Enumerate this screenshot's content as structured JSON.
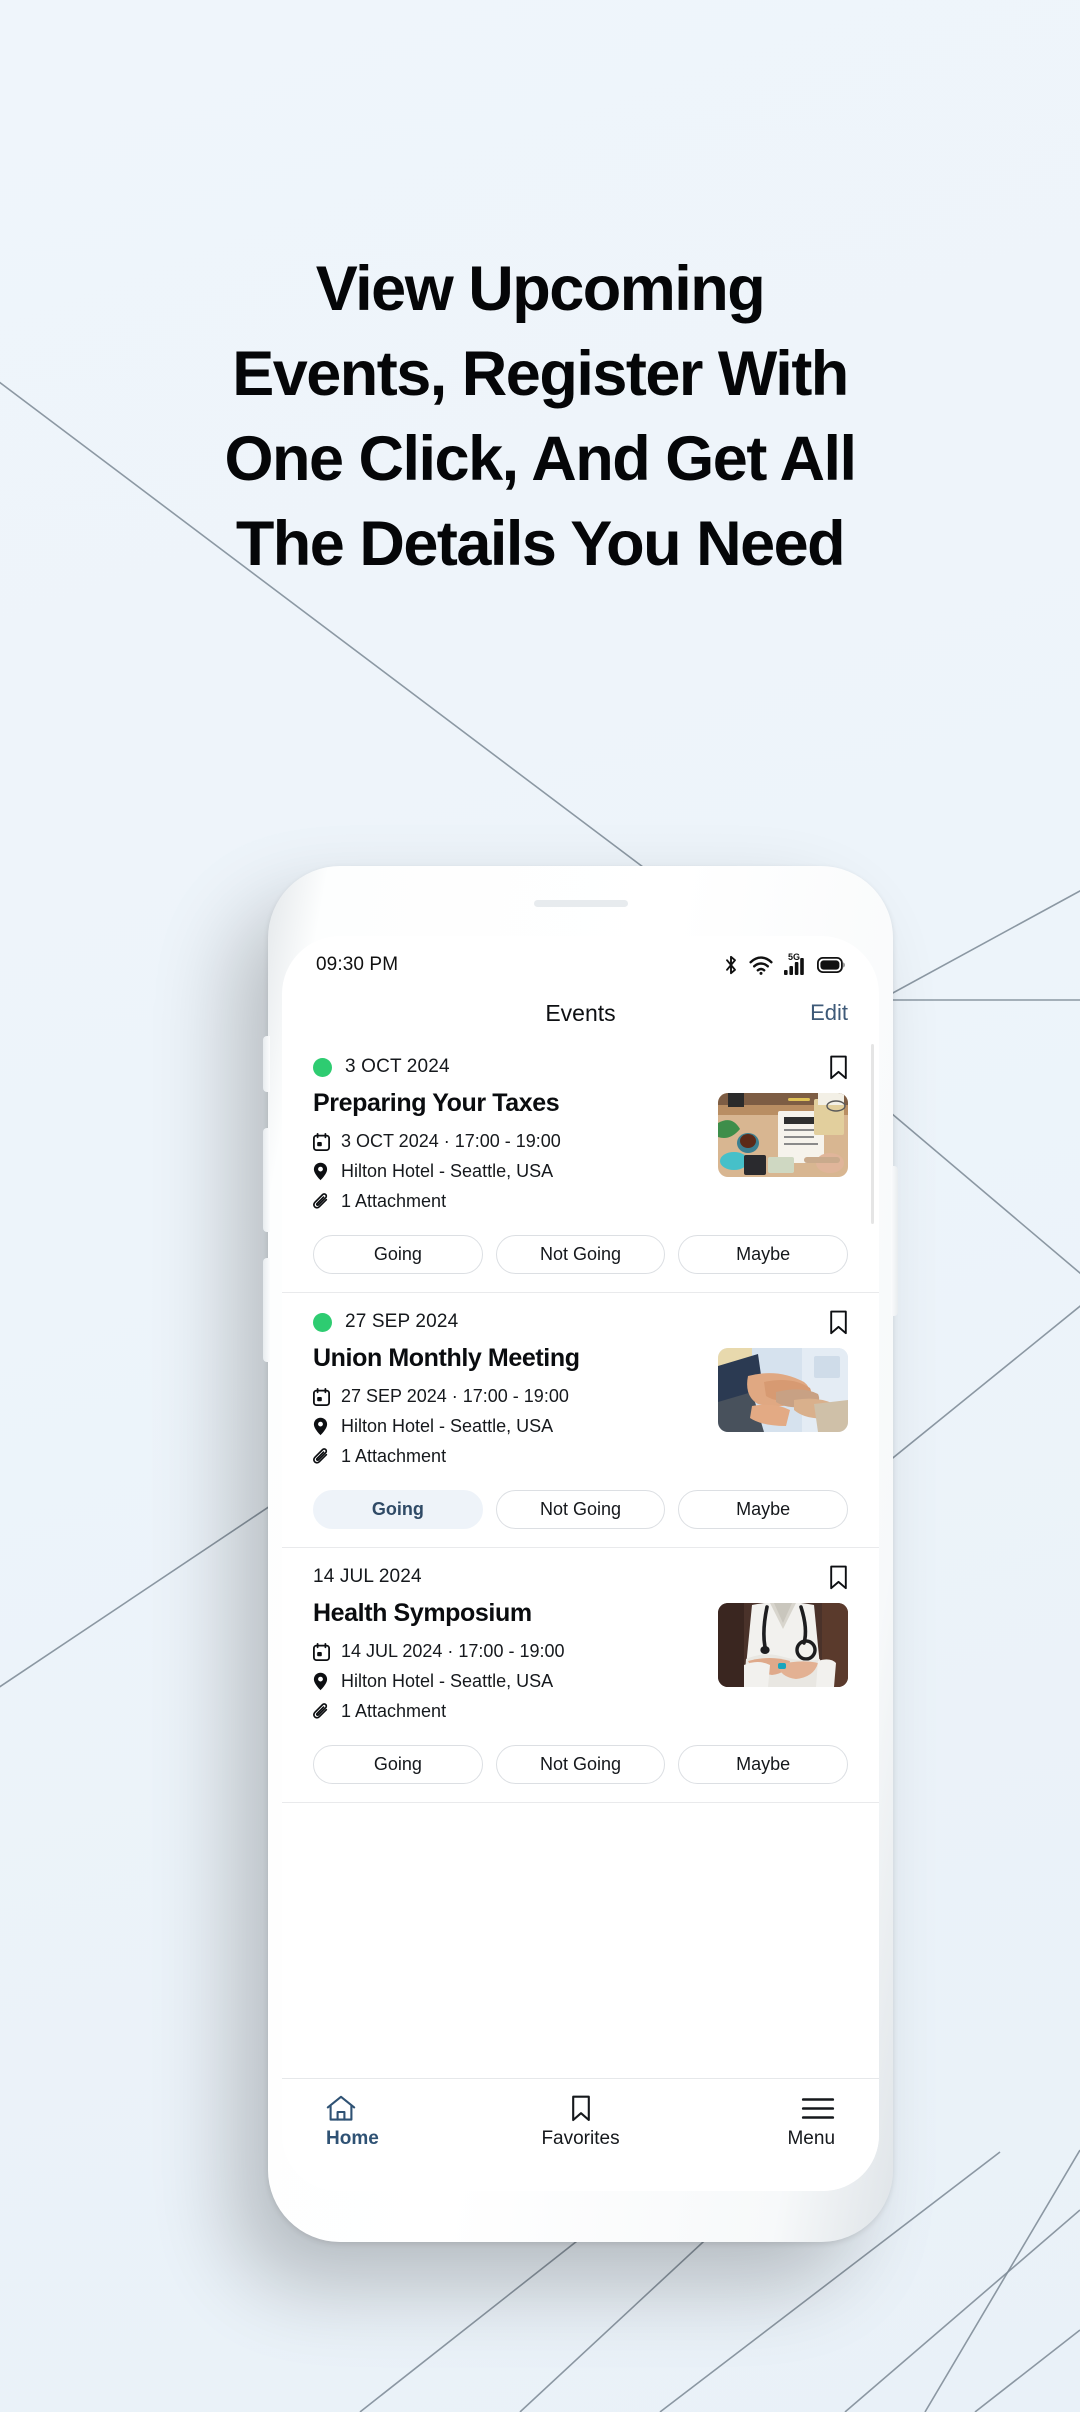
{
  "headline": {
    "lines": [
      "View Upcoming",
      "Events, Register With",
      "One Click, And Get All",
      "The Details You Need"
    ]
  },
  "colors": {
    "background": "#eef5fb",
    "accent_blue": "#3e5a78",
    "status_green": "#2ecc71",
    "selected_chip_bg": "#eef3f9",
    "selected_chip_text": "#2f4a66",
    "line_gray": "#7b8894"
  },
  "phone": {
    "status_bar": {
      "time": "09:30 PM",
      "icons": [
        "bluetooth-icon",
        "wifi-icon",
        "cellular-5g-icon",
        "battery-icon"
      ],
      "network_label": "5G"
    },
    "nav": {
      "title": "Events",
      "edit_label": "Edit"
    },
    "events": [
      {
        "date_label": "3 OCT 2024",
        "has_status_dot": true,
        "title": "Preparing Your Taxes",
        "datetime": "3 OCT 2024 · 17:00 - 19:00",
        "location": "Hilton Hotel - Seattle, USA",
        "attachments": "1 Attachment",
        "thumb_name": "desk-tax-paperwork-photo",
        "rsvp": [
          {
            "label": "Going",
            "selected": false
          },
          {
            "label": "Not Going",
            "selected": false
          },
          {
            "label": "Maybe",
            "selected": false
          }
        ]
      },
      {
        "date_label": "27 SEP 2024",
        "has_status_dot": true,
        "title": "Union Monthly Meeting",
        "datetime": "27 SEP 2024 · 17:00 - 19:00",
        "location": "Hilton Hotel - Seattle, USA",
        "attachments": "1 Attachment",
        "thumb_name": "handshake-photo",
        "rsvp": [
          {
            "label": "Going",
            "selected": true
          },
          {
            "label": "Not Going",
            "selected": false
          },
          {
            "label": "Maybe",
            "selected": false
          }
        ]
      },
      {
        "date_label": "14 JUL 2024",
        "has_status_dot": false,
        "title": "Health Symposium",
        "datetime": "14 JUL 2024 · 17:00 - 19:00",
        "location": "Hilton Hotel - Seattle, USA",
        "attachments": "1 Attachment",
        "thumb_name": "doctor-stethoscope-photo",
        "rsvp": [
          {
            "label": "Going",
            "selected": false
          },
          {
            "label": "Not Going",
            "selected": false
          },
          {
            "label": "Maybe",
            "selected": false
          }
        ]
      }
    ],
    "tab_bar": [
      {
        "label": "Home",
        "icon": "home-icon",
        "active": true
      },
      {
        "label": "Favorites",
        "icon": "bookmark-icon",
        "active": false
      },
      {
        "label": "Menu",
        "icon": "hamburger-menu-icon",
        "active": false
      }
    ]
  }
}
